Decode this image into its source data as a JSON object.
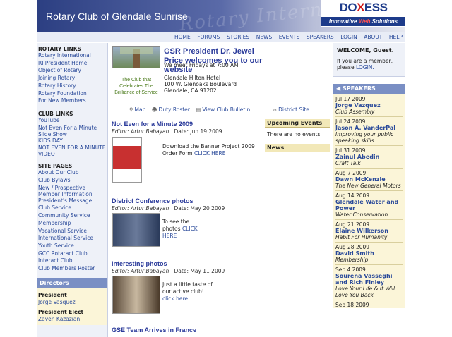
{
  "header": {
    "title": "Rotary Club of Glendale Sunrise",
    "watermark": "Rotary International"
  },
  "logo": {
    "brand_a": "DO",
    "brand_b": "X",
    "brand_c": "ESS",
    "tag_a": "Innovative ",
    "tag_b": "Web",
    "tag_c": " Solutions"
  },
  "nav": [
    "HOME",
    "FORUMS",
    "STORIES",
    "NEWS",
    "EVENTS",
    "SPEAKERS",
    "LOGIN",
    "ABOUT",
    "HELP"
  ],
  "left": {
    "rotary_links_title": "ROTARY LINKS",
    "rotary_links": [
      "Rotary International",
      "RI President Home",
      "Object of Rotary",
      "Joining Rotary",
      "Rotary History",
      "Rotary Foundation",
      "For New Members"
    ],
    "club_links_title": "CLUB LINKS",
    "club_links": [
      "YouTube",
      "Not Even For a Minute Slide Show",
      "KIDS DAY",
      "NOT EVEN FOR A MINUTE VIDEO"
    ],
    "site_pages_title": "SITE PAGES",
    "site_pages": [
      "About Our Club",
      "Club Bylaws",
      "New / Prospective Member Information",
      "President's Message",
      "Club Service",
      "Community Service",
      "Membership",
      "Vocational Service",
      "International Service",
      "Youth Service",
      "GCC Rotaract Club",
      "Interact Club",
      "Club Members Roster"
    ],
    "directors_title": "Directors",
    "directors": [
      {
        "role": "President",
        "name": "Jorge Vasquez"
      },
      {
        "role": "President Elect",
        "name": "Zaven Kazazian"
      }
    ]
  },
  "welcome": {
    "caption": "The Club that Celebrates The Brilliance of Service",
    "title": "GSR President Dr. Jewel Price welcomes you to our website",
    "meet": "We meet Fridays at 7:00 AM",
    "addr1": "Glendale Hilton Hotel",
    "addr2": "100 W. Glenoaks Boulevard",
    "addr3": "Glendale, CA 91202"
  },
  "quick_links": {
    "map": "Map",
    "roster": "Duty Roster",
    "bulletin": "View Club Bulletin",
    "district": "District Site"
  },
  "news": [
    {
      "title": "Not Even for a Minute 2009",
      "editor": "Editor: Artur Babayan",
      "date": "Date: Jun 19 2009",
      "text": "Download the Banner Project 2009 Order Form ",
      "link": "CLICK HERE"
    },
    {
      "title": "District Conference photos",
      "editor": "Editor: Artur Babayan",
      "date": "Date: May 20 2009",
      "text": "To see the photos ",
      "link": "CLICK HERE"
    },
    {
      "title": "Interesting photos",
      "editor": "Editor: Artur Babayan",
      "date": "Date: May 11 2009",
      "text": "Just a little taste of our active club! ",
      "link": "click here"
    },
    {
      "title": "GSE Team Arrives in France",
      "editor": "",
      "date": "",
      "text": "",
      "link": ""
    }
  ],
  "upcoming": {
    "title": "Upcoming Events",
    "text": "There are no events.",
    "news_title": "News"
  },
  "guest": {
    "title": "WELCOME, Guest.",
    "text": "If you are a member, please ",
    "login": "LOGIN."
  },
  "speakers": {
    "title": "SPEAKERS",
    "items": [
      {
        "date": "Jul 17 2009",
        "name": "Jorge Vazquez",
        "topic": "Club Assembly"
      },
      {
        "date": "Jul 24 2009",
        "name": "Jason A. VanderPal",
        "topic": "Improving your public speaking skills."
      },
      {
        "date": "Jul 31 2009",
        "name": "Zainul Abedin",
        "topic": "Craft Talk"
      },
      {
        "date": "Aug 7 2009",
        "name": "Dawn McKenzie",
        "topic": "The New General Motors"
      },
      {
        "date": "Aug 14 2009",
        "name": "Glendale Water and Power",
        "topic": "Water Conservation"
      },
      {
        "date": "Aug 21 2009",
        "name": "Elaine Wilkerson",
        "topic": "Habit For Humanity"
      },
      {
        "date": "Aug 28 2009",
        "name": "David Smith",
        "topic": "Membership"
      },
      {
        "date": "Sep 4 2009",
        "name": "Sourena Vasseghi and Rich Finley",
        "topic": "Love Your Life & It Will Love You Back"
      },
      {
        "date": "Sep 18 2009",
        "name": "",
        "topic": ""
      }
    ]
  }
}
